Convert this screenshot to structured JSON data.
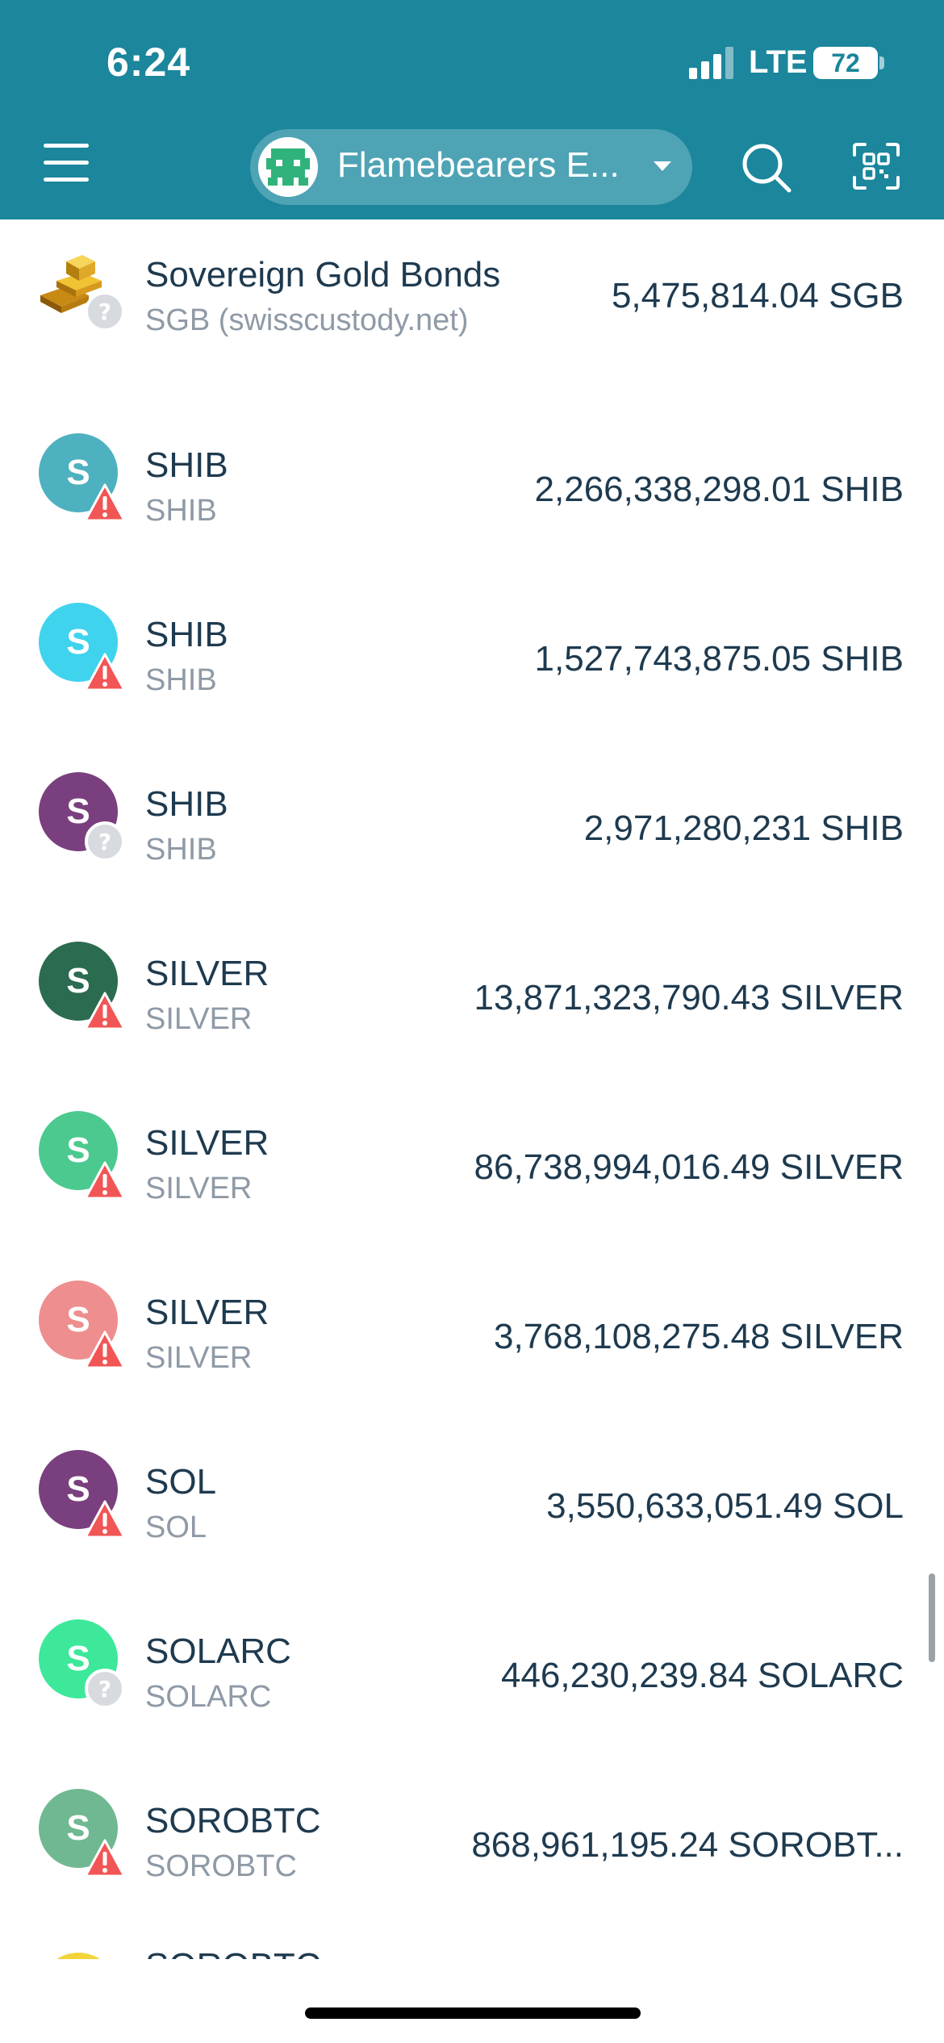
{
  "status": {
    "time": "6:24",
    "network": "LTE",
    "battery": "72"
  },
  "header": {
    "wallet_name": "Flamebearers E...",
    "menu_icon": "hamburger-menu-icon",
    "search_icon": "search-icon",
    "scan_icon": "qr-scan-icon"
  },
  "tokens": [
    {
      "name": "Sovereign Gold Bonds",
      "code": "SGB (swisscustody.net)",
      "amount": "5,475,814.04 SGB",
      "letter": "",
      "color": "#d4a017",
      "badge": "question"
    },
    {
      "name": "SHIB",
      "code": "SHIB",
      "amount": "2,266,338,298.01 SHIB",
      "letter": "S",
      "color": "#4eb1c0",
      "badge": "warning"
    },
    {
      "name": "SHIB",
      "code": "SHIB",
      "amount": "1,527,743,875.05 SHIB",
      "letter": "S",
      "color": "#3fd3ee",
      "badge": "warning"
    },
    {
      "name": "SHIB",
      "code": "SHIB",
      "amount": "2,971,280,231 SHIB",
      "letter": "S",
      "color": "#7a3f7e",
      "badge": "question"
    },
    {
      "name": "SILVER",
      "code": "SILVER",
      "amount": "13,871,323,790.43 SILVER",
      "letter": "S",
      "color": "#2b6b4f",
      "badge": "warning"
    },
    {
      "name": "SILVER",
      "code": "SILVER",
      "amount": "86,738,994,016.49 SILVER",
      "letter": "S",
      "color": "#4cc98e",
      "badge": "warning"
    },
    {
      "name": "SILVER",
      "code": "SILVER",
      "amount": "3,768,108,275.48 SILVER",
      "letter": "S",
      "color": "#ee8e8e",
      "badge": "warning"
    },
    {
      "name": "SOL",
      "code": "SOL",
      "amount": "3,550,633,051.49 SOL",
      "letter": "S",
      "color": "#7a3f7e",
      "badge": "warning"
    },
    {
      "name": "SOLARC",
      "code": "SOLARC",
      "amount": "446,230,239.84 SOLARC",
      "letter": "S",
      "color": "#3de89a",
      "badge": "question"
    },
    {
      "name": "SOROBTC",
      "code": "SOROBTC",
      "amount": "868,961,195.24 SOROBT...",
      "letter": "S",
      "color": "#6fb892",
      "badge": "warning"
    }
  ]
}
